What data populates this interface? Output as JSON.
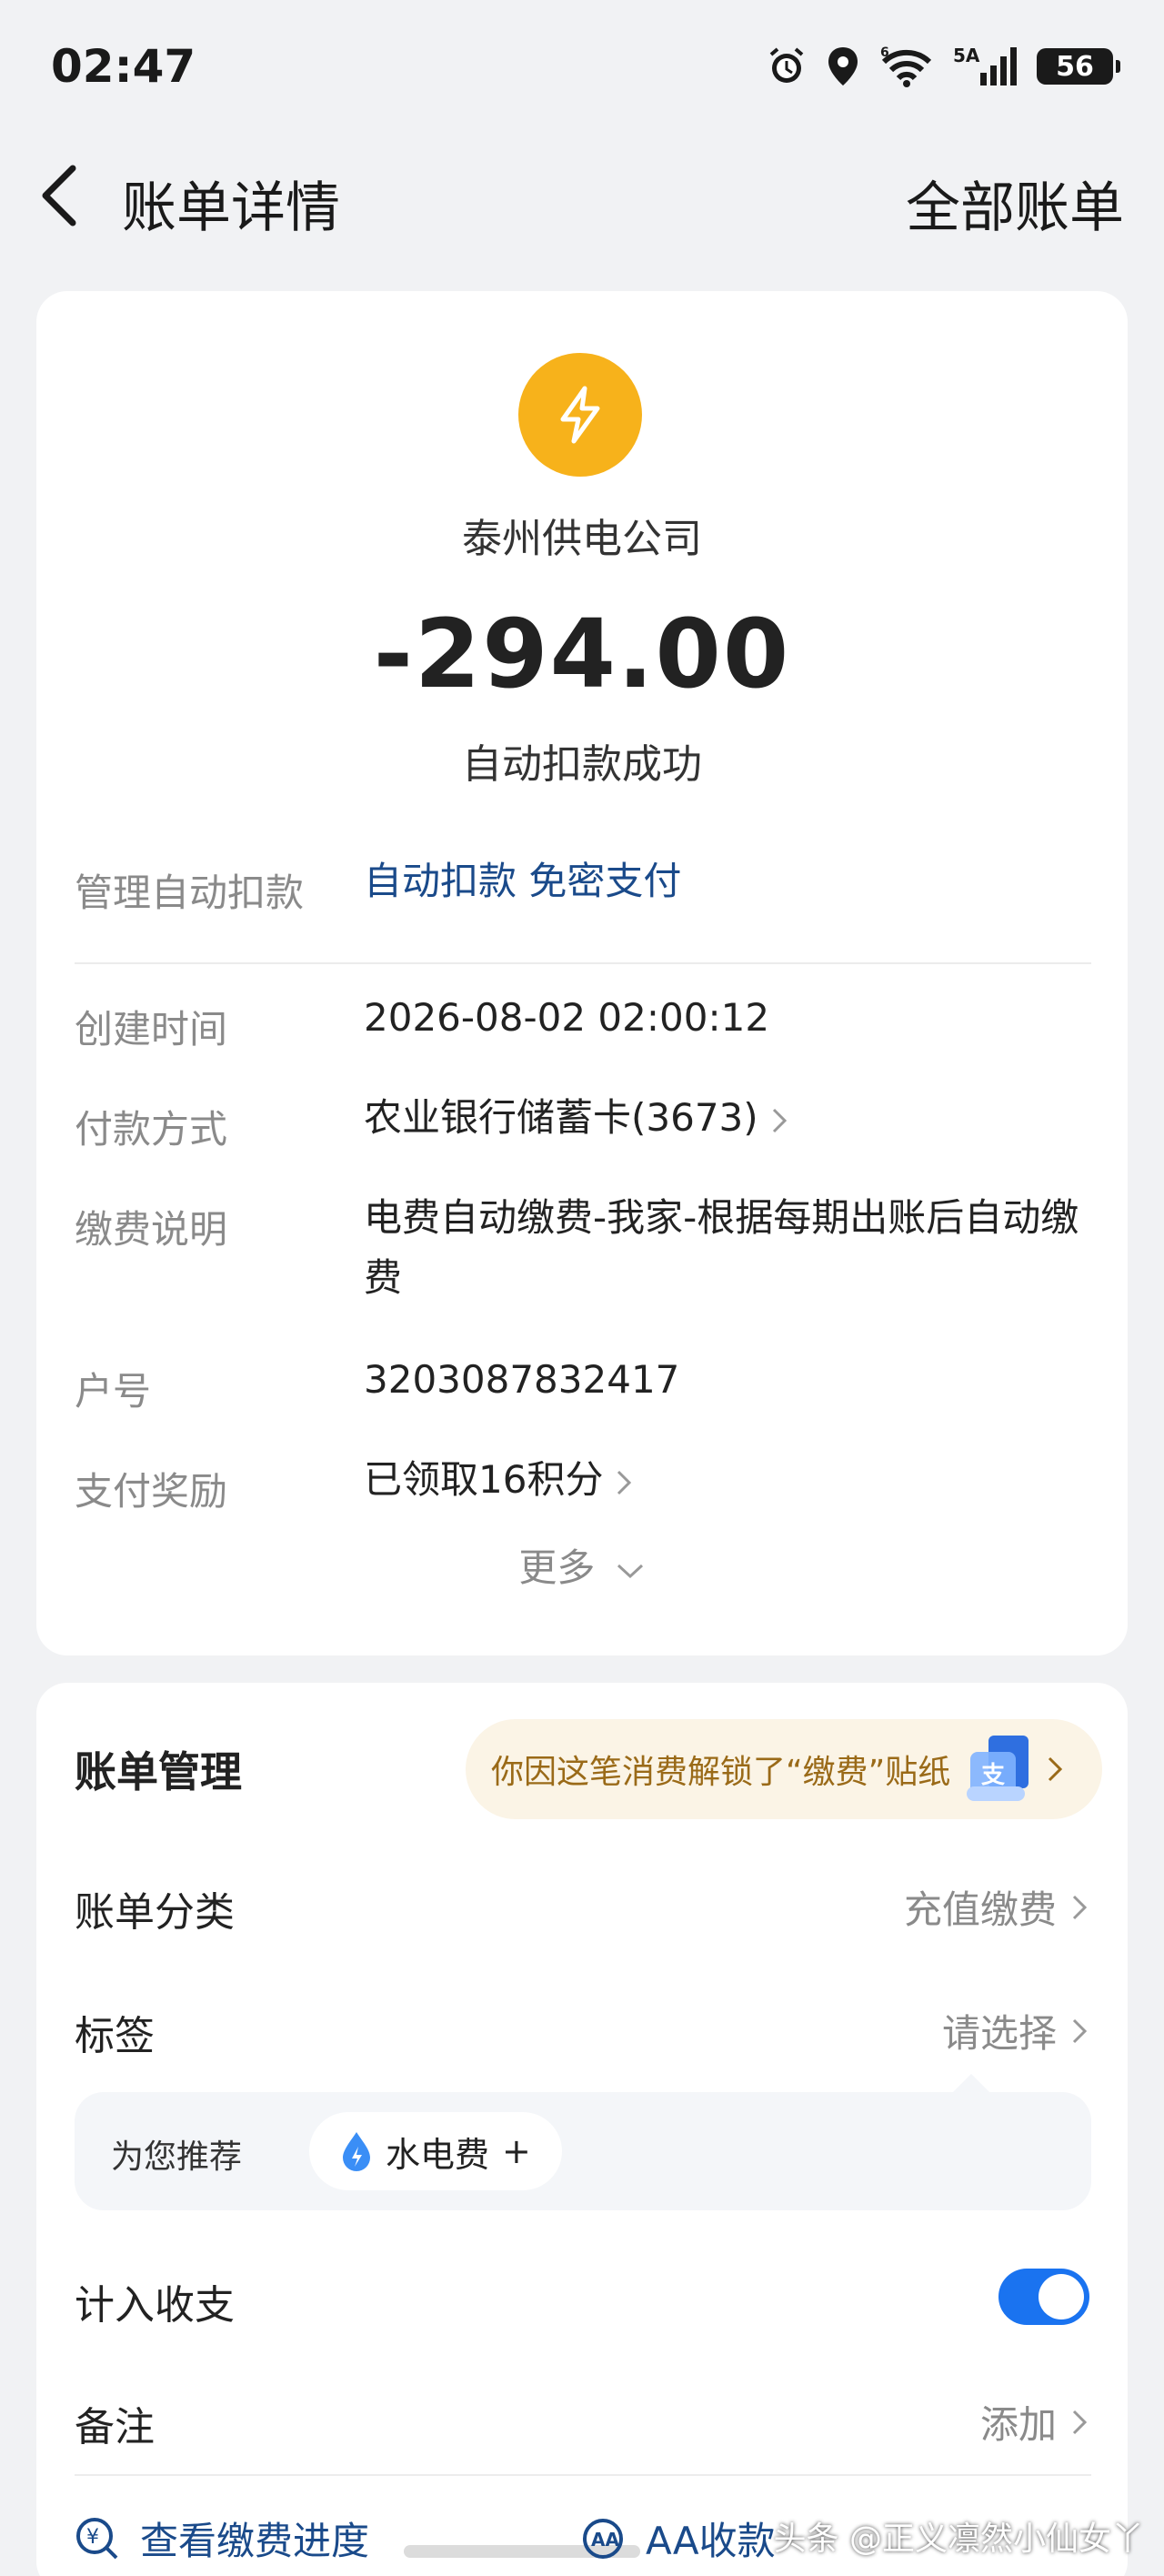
{
  "status_bar": {
    "time": "02:47",
    "network_label": "5A",
    "battery_level": "56",
    "icons": [
      "alarm-icon",
      "location-icon",
      "wifi-icon",
      "signal-icon",
      "battery-icon"
    ]
  },
  "header": {
    "title": "账单详情",
    "right_action": "全部账单"
  },
  "summary": {
    "merchant_icon": "lightning-icon",
    "merchant_icon_color": "#f7b21b",
    "merchant": "泰州供电公司",
    "amount": "-294.00",
    "status": "自动扣款成功"
  },
  "autopay": {
    "label": "管理自动扣款",
    "value": "自动扣款 免密支付"
  },
  "details": [
    {
      "label": "创建时间",
      "value": "2026-08-02 02:00:12"
    },
    {
      "label": "付款方式",
      "value": "农业银行储蓄卡(3673)"
    },
    {
      "label": "缴费说明",
      "value": "电费自动缴费-我家-根据每期出账后自动缴费"
    },
    {
      "label": "户号",
      "value": "3203087832417"
    },
    {
      "label": "支付奖励",
      "value": "已领取16积分"
    }
  ],
  "more_label": "更多",
  "bill_management": {
    "title": "账单管理",
    "promo_text": "你因这笔消费解锁了“缴费”贴纸",
    "promo_sticker_text": "支",
    "category": {
      "label": "账单分类",
      "value": "充值缴费"
    },
    "tags": {
      "label": "标签",
      "value": "请选择"
    },
    "recommend": {
      "label": "为您推荐",
      "chip": "水电费",
      "chip_add": "+"
    },
    "include_in_stats": {
      "label": "计入收支",
      "enabled": true
    },
    "note": {
      "label": "备注",
      "value": "添加"
    },
    "bottom_actions": [
      {
        "label": "查看缴费进度",
        "icon": "yuan-search-icon"
      },
      {
        "label": "AA收款",
        "icon": "aa-icon"
      }
    ]
  },
  "watermark": "头条 @正义凛然小仙女丫",
  "colors": {
    "accent": "#1a73f0",
    "link": "#1a4a8a",
    "promo_bg": "#fbf4e6",
    "promo_text": "#9a6a18"
  }
}
